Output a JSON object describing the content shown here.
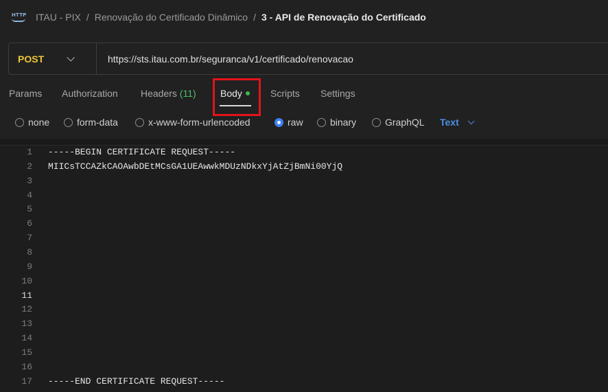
{
  "breadcrumb": {
    "icon": "http-request-icon",
    "icon_text": "HTTP",
    "items": [
      "ITAU - PIX",
      "Renovação do Certificado Dinâmico"
    ],
    "separator": "/",
    "current": "3 - API de Renovação do Certificado"
  },
  "request": {
    "method": "POST",
    "url": "https://sts.itau.com.br/seguranca/v1/certificado/renovacao"
  },
  "tabs": {
    "params": "Params",
    "authorization": "Authorization",
    "headers": "Headers",
    "headers_count": "(11)",
    "body": "Body",
    "scripts": "Scripts",
    "settings": "Settings",
    "active": "Body"
  },
  "body_types": {
    "options": [
      "none",
      "form-data",
      "x-www-form-urlencoded",
      "raw",
      "binary",
      "GraphQL"
    ],
    "selected": "raw",
    "format": "Text"
  },
  "editor": {
    "lines": [
      {
        "n": "1",
        "text": "-----BEGIN CERTIFICATE REQUEST-----"
      },
      {
        "n": "2",
        "text": "MIICsTCCAZkCAOAwbDEtMCsGA1UEAwwkMDUzNDkxYjAtZjBmNi00YjQ"
      },
      {
        "n": "3",
        "text": ""
      },
      {
        "n": "4",
        "text": ""
      },
      {
        "n": "5",
        "text": ""
      },
      {
        "n": "6",
        "text": ""
      },
      {
        "n": "7",
        "text": ""
      },
      {
        "n": "8",
        "text": ""
      },
      {
        "n": "9",
        "text": ""
      },
      {
        "n": "10",
        "text": ""
      },
      {
        "n": "11",
        "text": ""
      },
      {
        "n": "12",
        "text": ""
      },
      {
        "n": "13",
        "text": ""
      },
      {
        "n": "14",
        "text": ""
      },
      {
        "n": "15",
        "text": ""
      },
      {
        "n": "16",
        "text": ""
      },
      {
        "n": "17",
        "text": "-----END CERTIFICATE REQUEST-----"
      }
    ],
    "active_line": "11"
  },
  "colors": {
    "method": "#f0c63a",
    "accent": "#3b82f6",
    "modified_dot": "#3fb950",
    "highlight": "#e3141a"
  }
}
